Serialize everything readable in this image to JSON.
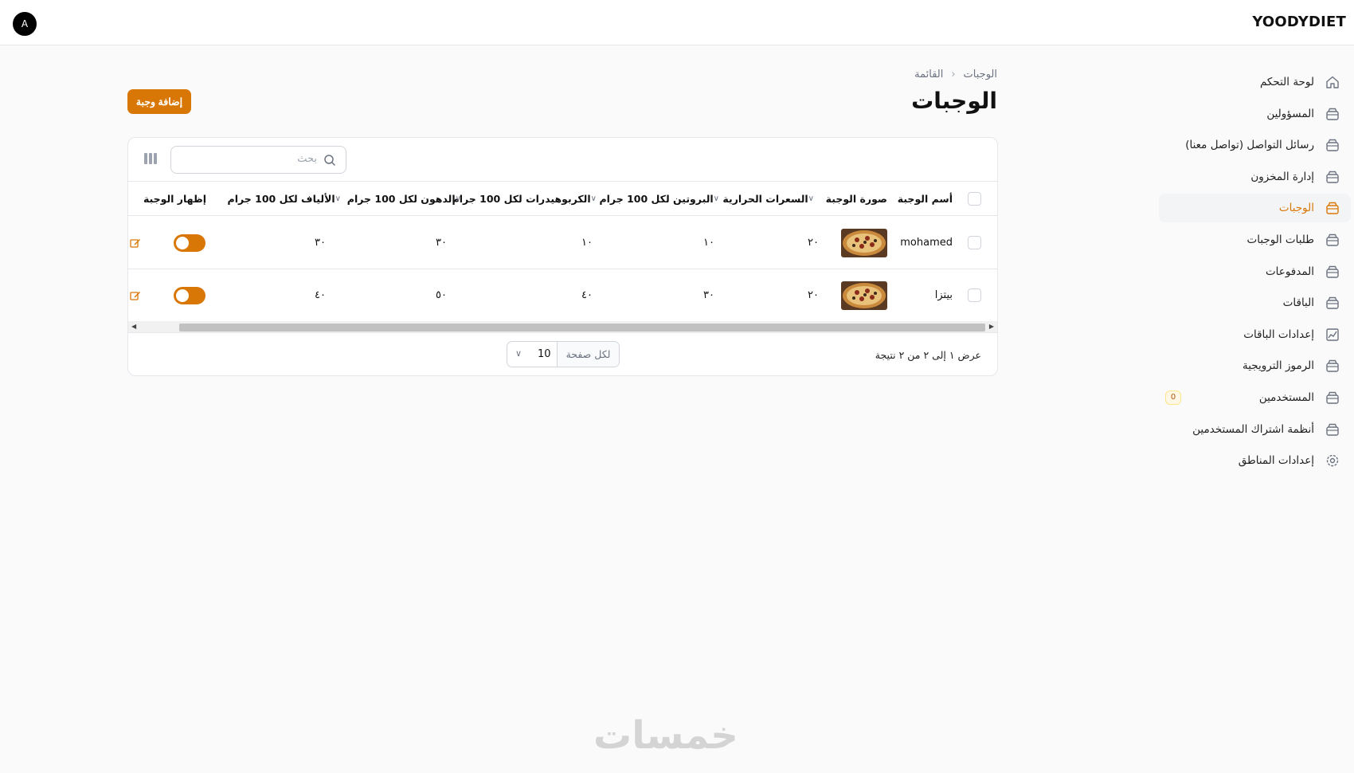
{
  "header": {
    "brand": "YOODYDIET",
    "avatar_initial": "A"
  },
  "sidebar": {
    "items": [
      {
        "label": "لوحة التحكم",
        "icon": "home-icon",
        "active": false
      },
      {
        "label": "المسؤولين",
        "icon": "box-icon",
        "active": false
      },
      {
        "label": "رسائل التواصل (تواصل معنا)",
        "icon": "box-icon",
        "active": false
      },
      {
        "label": "إدارة المخزون",
        "icon": "box-icon",
        "active": false
      },
      {
        "label": "الوجبات",
        "icon": "box-icon",
        "active": true
      },
      {
        "label": "طلبات الوجبات",
        "icon": "box-icon",
        "active": false
      },
      {
        "label": "المدفوعات",
        "icon": "box-icon",
        "active": false
      },
      {
        "label": "الباقات",
        "icon": "box-icon",
        "active": false
      },
      {
        "label": "إعدادات الباقات",
        "icon": "chart-icon",
        "active": false
      },
      {
        "label": "الرموز الترويجية",
        "icon": "box-icon",
        "active": false
      },
      {
        "label": "المستخدمين",
        "icon": "box-icon",
        "active": false,
        "badge": "0"
      },
      {
        "label": "أنظمة اشتراك المستخدمين",
        "icon": "box-icon",
        "active": false
      },
      {
        "label": "إعدادات المناطق",
        "icon": "gear-icon",
        "active": false
      }
    ]
  },
  "breadcrumb": {
    "parent": "الوجبات",
    "current": "القائمة"
  },
  "page": {
    "title": "الوجبات",
    "add_button": "إضافة وجبة"
  },
  "search": {
    "placeholder": "بحث"
  },
  "table": {
    "headers": {
      "name": "أسم الوجبة",
      "image": "صورة الوجبة",
      "calories": "السعرات الحرارية",
      "protein": "البروتين لكل 100 جرام",
      "carbs": "الكربوهيدرات لكل 100 جرام",
      "fats": "الدهون لكل 100 جرام",
      "fiber": "الألياف لكل 100 جرام",
      "visible": "إظهار الوجبة"
    },
    "rows": [
      {
        "name": "mohamed",
        "calories": "٢٠",
        "protein": "١٠",
        "carbs": "١٠",
        "fats": "٣٠",
        "fiber": "٣٠",
        "visible": true
      },
      {
        "name": "بيتزا",
        "calories": "٢٠",
        "protein": "٣٠",
        "carbs": "٤٠",
        "fats": "٥٠",
        "fiber": "٤٠",
        "visible": true
      }
    ]
  },
  "pagination": {
    "summary": "عرض ١ إلى ٢ من ٢ نتيجة",
    "per_page_label": "لكل صفحة",
    "per_page_value": "10"
  },
  "colors": {
    "accent": "#d97706"
  },
  "watermark": "خمسات"
}
